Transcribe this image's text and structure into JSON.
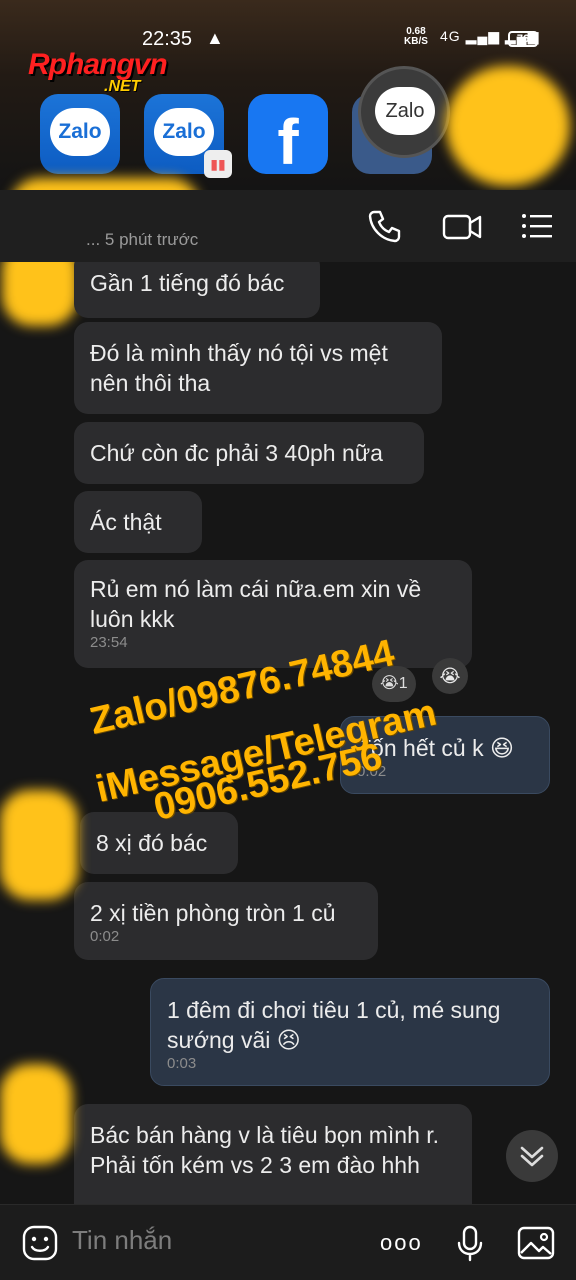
{
  "status_bar": {
    "time": "22:35",
    "warning_icon": "warning-icon",
    "net_speed_value": "0.68",
    "net_speed_unit": "KB/S",
    "network": "4G",
    "battery": "76"
  },
  "watermark": {
    "brand": "Rphangvn",
    "domain": ".NET",
    "contact_line1": "Zalo/09876.74844",
    "contact_line2": "iMessage/Telegram",
    "contact_line3": "0906.552.756"
  },
  "app_shortcuts": [
    {
      "name": "Zalo"
    },
    {
      "name": "Zalo"
    },
    {
      "name": "f"
    },
    {
      "name": "Zalo"
    }
  ],
  "header": {
    "last_seen": "... 5 phút trước",
    "icons": [
      "phone-icon",
      "video-call-icon",
      "menu-icon"
    ]
  },
  "messages": [
    {
      "dir": "in",
      "text": "Gần 1 tiếng đó bác"
    },
    {
      "dir": "in",
      "text": "Đó là mình thấy nó tội vs mệt nên thôi tha"
    },
    {
      "dir": "in",
      "text": "Chứ còn đc phải 3 40ph nữa"
    },
    {
      "dir": "in",
      "text": "Ác thật"
    },
    {
      "dir": "in",
      "text": "Rủ em nó làm cái nữa.em xin về luôn kkk",
      "time": "23:54",
      "reaction_count": "1"
    },
    {
      "dir": "out",
      "text": "Tốn hết củ k",
      "emoji": "😆",
      "time": "0:02"
    },
    {
      "dir": "in",
      "text": "8 xị đó bác"
    },
    {
      "dir": "in",
      "text": "2 xị tiền phòng tròn 1 củ",
      "time": "0:02"
    },
    {
      "dir": "out",
      "text": "1 đêm đi chơi tiêu 1 củ, mé sung sướng vãi",
      "emoji": "😣",
      "time": "0:03"
    },
    {
      "dir": "in",
      "text": "Bác bán hàng v là tiêu bọn mình r. Phải tốn kém vs 2 3 em đào hhh"
    }
  ],
  "composer": {
    "placeholder": "Tin nhắn",
    "more_label": "ooo"
  },
  "colors": {
    "incoming_bubble": "#2c2c2e",
    "outgoing_bubble": "#2b3646",
    "watermark_orange": "#ffb400"
  }
}
